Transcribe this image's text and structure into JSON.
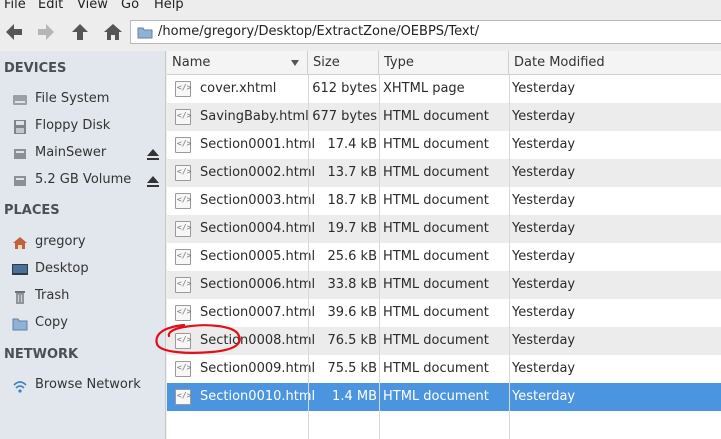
{
  "menubar": {
    "items": [
      "File",
      "Edit",
      "View",
      "Go",
      "Help"
    ]
  },
  "location": {
    "path": "/home/gregory/Desktop/ExtractZone/OEBPS/Text/"
  },
  "sidebar": {
    "devices_header": "DEVICES",
    "devices": [
      {
        "label": "File System",
        "icon": "harddisk-icon"
      },
      {
        "label": "Floppy Disk",
        "icon": "floppy-icon"
      },
      {
        "label": "MainSewer",
        "icon": "drive-icon",
        "eject": true
      },
      {
        "label": "5.2 GB Volume",
        "icon": "drive-icon",
        "eject": true
      }
    ],
    "places_header": "PLACES",
    "places": [
      {
        "label": "gregory",
        "icon": "home-icon"
      },
      {
        "label": "Desktop",
        "icon": "desktop-icon"
      },
      {
        "label": "Trash",
        "icon": "trash-icon"
      },
      {
        "label": "Copy",
        "icon": "folder-icon"
      }
    ],
    "network_header": "NETWORK",
    "network": [
      {
        "label": "Browse Network",
        "icon": "network-icon"
      }
    ]
  },
  "columns": {
    "name": "Name",
    "size": "Size",
    "type": "Type",
    "date": "Date Modified"
  },
  "files": [
    {
      "name": "cover.xhtml",
      "size": "612 bytes",
      "type": "XHTML page",
      "date": "Yesterday"
    },
    {
      "name": "SavingBaby.html",
      "size": "677 bytes",
      "type": "HTML document",
      "date": "Yesterday"
    },
    {
      "name": "Section0001.html",
      "size": "17.4 kB",
      "type": "HTML document",
      "date": "Yesterday"
    },
    {
      "name": "Section0002.html",
      "size": "13.7 kB",
      "type": "HTML document",
      "date": "Yesterday"
    },
    {
      "name": "Section0003.html",
      "size": "18.7 kB",
      "type": "HTML document",
      "date": "Yesterday"
    },
    {
      "name": "Section0004.html",
      "size": "19.7 kB",
      "type": "HTML document",
      "date": "Yesterday"
    },
    {
      "name": "Section0005.html",
      "size": "25.6 kB",
      "type": "HTML document",
      "date": "Yesterday"
    },
    {
      "name": "Section0006.html",
      "size": "33.8 kB",
      "type": "HTML document",
      "date": "Yesterday"
    },
    {
      "name": "Section0007.html",
      "size": "39.6 kB",
      "type": "HTML document",
      "date": "Yesterday"
    },
    {
      "name": "Section0008.html",
      "size": "76.5 kB",
      "type": "HTML document",
      "date": "Yesterday"
    },
    {
      "name": "Section0009.html",
      "size": "75.5 kB",
      "type": "HTML document",
      "date": "Yesterday"
    },
    {
      "name": "Section0010.html",
      "size": "1.4 MB",
      "type": "HTML document",
      "date": "Yesterday",
      "selected": true
    }
  ],
  "colors": {
    "selection": "#4b95e0",
    "annotation": "#e0101a",
    "sidebar_bg": "#e2e7ed"
  }
}
